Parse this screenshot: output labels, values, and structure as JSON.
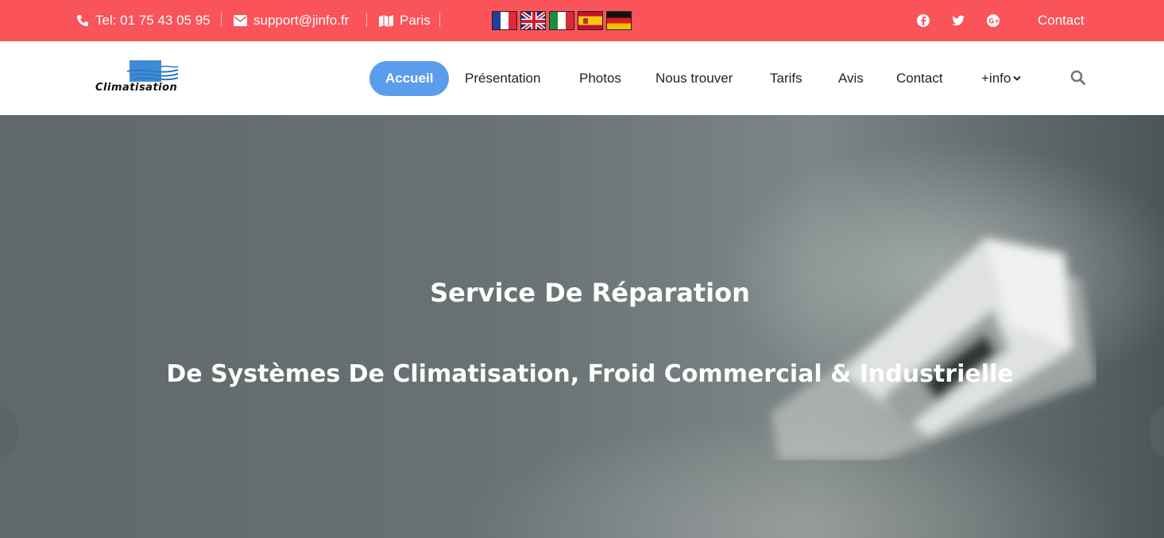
{
  "topbar": {
    "phone": "Tel: 01 75 43 05 95",
    "email": "support@jinfo.fr",
    "city": "Paris",
    "contact": "Contact",
    "bg_color": "#fa535a",
    "flags": [
      "fr-flag",
      "uk-flag",
      "it-flag",
      "es-flag",
      "de-flag"
    ],
    "social": [
      "facebook-icon",
      "twitter-icon",
      "google-plus-icon"
    ]
  },
  "header": {
    "logo_text": "Climatisation",
    "nav": [
      "Accueil",
      "Présentation",
      "Photos",
      "Nous trouver",
      "Tarifs",
      "Avis",
      "Contact",
      "+info"
    ],
    "active_color": "#5b9cec"
  },
  "hero": {
    "title": "Service De Réparation",
    "subtitle": "De Systèmes De Climatisation, Froid Commercial & Industrielle"
  }
}
